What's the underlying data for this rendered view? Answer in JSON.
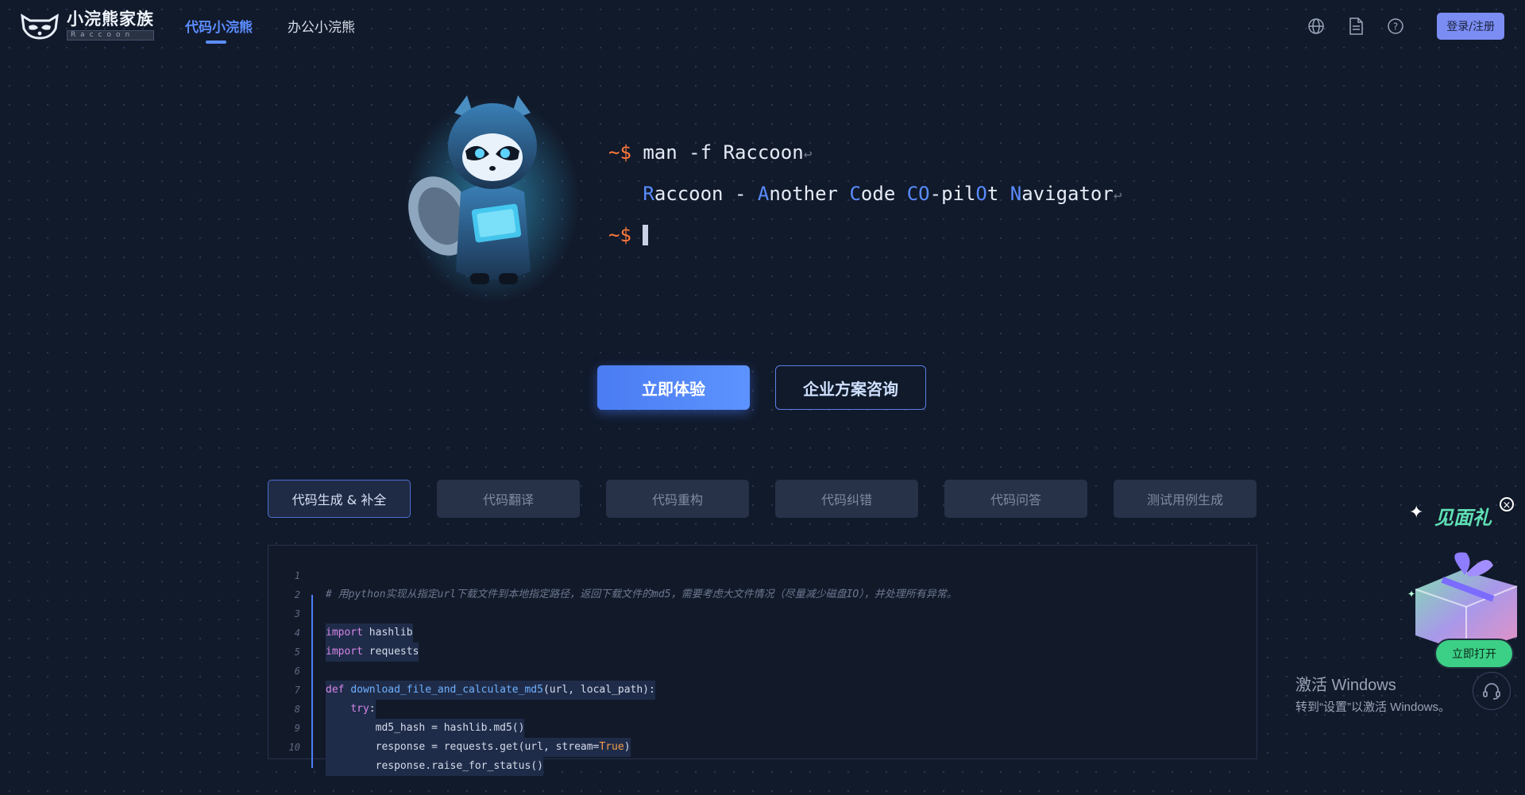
{
  "header": {
    "brand_cn": "小浣熊家族",
    "brand_en": "Raccoon",
    "nav": [
      {
        "label": "代码小浣熊",
        "active": true
      },
      {
        "label": "办公小浣熊",
        "active": false
      }
    ],
    "tools": [
      "globe-icon",
      "document-icon",
      "help-icon"
    ],
    "login_label": "登录/注册"
  },
  "hero": {
    "prompt": "~$",
    "command": "man -f Raccoon",
    "desc_parts": [
      "R",
      "accoon - ",
      "A",
      "nother ",
      "C",
      "ode ",
      "CO",
      "-pil",
      "O",
      "t ",
      "N",
      "avigator"
    ],
    "return_glyph": "↩"
  },
  "cta": {
    "primary": "立即体验",
    "secondary": "企业方案咨询"
  },
  "tabs": [
    {
      "label": "代码生成 & 补全",
      "active": true
    },
    {
      "label": "代码翻译",
      "active": false
    },
    {
      "label": "代码重构",
      "active": false
    },
    {
      "label": "代码纠错",
      "active": false
    },
    {
      "label": "代码问答",
      "active": false
    },
    {
      "label": "测试用例生成",
      "active": false
    }
  ],
  "code": {
    "line_numbers": [
      "1",
      "2",
      "3",
      "4",
      "5",
      "6",
      "7",
      "8",
      "9",
      "10"
    ],
    "comment": "# 用python实现从指定url下载文件到本地指定路径，返回下载文件的md5，需要考虑大文件情况（尽量减少磁盘IO），并处理所有异常。",
    "kw_import": "import",
    "mod_hashlib": " hashlib",
    "mod_requests": " requests",
    "kw_def": "def",
    "fn_name": "download_file_and_calculate_md5",
    "fn_args": "(url, local_path):",
    "kw_try": "try",
    "colon": ":",
    "l8": "md5_hash = hashlib.md5()",
    "l9a": "response = requests.get(url, stream=",
    "l9b": "True",
    "l9c": ")",
    "l10": "response.raise_for_status()"
  },
  "promo": {
    "sparkle": "✦",
    "title": "见面礼",
    "button": "立即打开",
    "close": "×"
  },
  "watermark": {
    "line1": "激活 Windows",
    "line2": "转到“设置”以激活 Windows。"
  },
  "colors": {
    "background": "#111a2b",
    "accent": "#5b8cff",
    "prompt": "#ff7a3a",
    "promo": "#3ccf86"
  }
}
